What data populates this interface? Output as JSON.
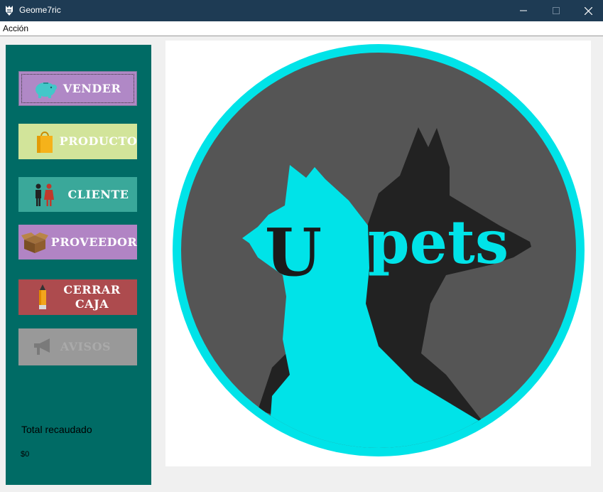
{
  "window": {
    "title": "Geome7ric"
  },
  "menu": {
    "items": [
      {
        "label": "Acción"
      }
    ]
  },
  "sidebar": {
    "buttons": [
      {
        "label": "VENDER",
        "icon": "piggy-bank-icon"
      },
      {
        "label": "PRODUCTO",
        "icon": "shopping-bag-icon"
      },
      {
        "label": "CLIENTE",
        "icon": "people-icon"
      },
      {
        "label": "PROVEEDOR",
        "icon": "box-icon"
      },
      {
        "label": "CERRAR\nCAJA",
        "icon": "pencil-icon"
      },
      {
        "label": "AVISOS",
        "icon": "megaphone-icon"
      }
    ],
    "total_label": "Total recaudado",
    "total_value": "$0"
  },
  "logo": {
    "letter": "U",
    "word": "pets"
  },
  "colors": {
    "titlebar": "#1e3b54",
    "sidebar": "#006b65",
    "logo_cyan": "#00e3e8",
    "logo_dark_circle": "#555555",
    "logo_dog": "#222222"
  }
}
